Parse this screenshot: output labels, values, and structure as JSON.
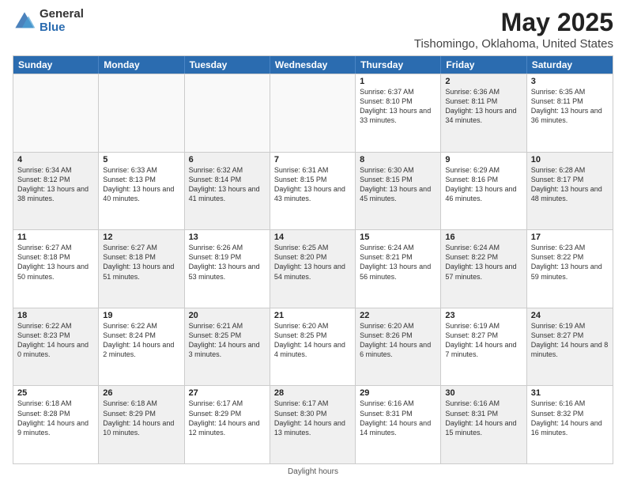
{
  "header": {
    "logo_general": "General",
    "logo_blue": "Blue",
    "month_year": "May 2025",
    "location": "Tishomingo, Oklahoma, United States"
  },
  "days_of_week": [
    "Sunday",
    "Monday",
    "Tuesday",
    "Wednesday",
    "Thursday",
    "Friday",
    "Saturday"
  ],
  "footer": {
    "daylight_hours": "Daylight hours"
  },
  "weeks": [
    [
      {
        "day": "",
        "sunrise": "",
        "sunset": "",
        "daylight": "",
        "shaded": false,
        "empty": true
      },
      {
        "day": "",
        "sunrise": "",
        "sunset": "",
        "daylight": "",
        "shaded": false,
        "empty": true
      },
      {
        "day": "",
        "sunrise": "",
        "sunset": "",
        "daylight": "",
        "shaded": false,
        "empty": true
      },
      {
        "day": "",
        "sunrise": "",
        "sunset": "",
        "daylight": "",
        "shaded": false,
        "empty": true
      },
      {
        "day": "1",
        "sunrise": "Sunrise: 6:37 AM",
        "sunset": "Sunset: 8:10 PM",
        "daylight": "Daylight: 13 hours and 33 minutes.",
        "shaded": false,
        "empty": false
      },
      {
        "day": "2",
        "sunrise": "Sunrise: 6:36 AM",
        "sunset": "Sunset: 8:11 PM",
        "daylight": "Daylight: 13 hours and 34 minutes.",
        "shaded": true,
        "empty": false
      },
      {
        "day": "3",
        "sunrise": "Sunrise: 6:35 AM",
        "sunset": "Sunset: 8:11 PM",
        "daylight": "Daylight: 13 hours and 36 minutes.",
        "shaded": false,
        "empty": false
      }
    ],
    [
      {
        "day": "4",
        "sunrise": "Sunrise: 6:34 AM",
        "sunset": "Sunset: 8:12 PM",
        "daylight": "Daylight: 13 hours and 38 minutes.",
        "shaded": true,
        "empty": false
      },
      {
        "day": "5",
        "sunrise": "Sunrise: 6:33 AM",
        "sunset": "Sunset: 8:13 PM",
        "daylight": "Daylight: 13 hours and 40 minutes.",
        "shaded": false,
        "empty": false
      },
      {
        "day": "6",
        "sunrise": "Sunrise: 6:32 AM",
        "sunset": "Sunset: 8:14 PM",
        "daylight": "Daylight: 13 hours and 41 minutes.",
        "shaded": true,
        "empty": false
      },
      {
        "day": "7",
        "sunrise": "Sunrise: 6:31 AM",
        "sunset": "Sunset: 8:15 PM",
        "daylight": "Daylight: 13 hours and 43 minutes.",
        "shaded": false,
        "empty": false
      },
      {
        "day": "8",
        "sunrise": "Sunrise: 6:30 AM",
        "sunset": "Sunset: 8:15 PM",
        "daylight": "Daylight: 13 hours and 45 minutes.",
        "shaded": true,
        "empty": false
      },
      {
        "day": "9",
        "sunrise": "Sunrise: 6:29 AM",
        "sunset": "Sunset: 8:16 PM",
        "daylight": "Daylight: 13 hours and 46 minutes.",
        "shaded": false,
        "empty": false
      },
      {
        "day": "10",
        "sunrise": "Sunrise: 6:28 AM",
        "sunset": "Sunset: 8:17 PM",
        "daylight": "Daylight: 13 hours and 48 minutes.",
        "shaded": true,
        "empty": false
      }
    ],
    [
      {
        "day": "11",
        "sunrise": "Sunrise: 6:27 AM",
        "sunset": "Sunset: 8:18 PM",
        "daylight": "Daylight: 13 hours and 50 minutes.",
        "shaded": false,
        "empty": false
      },
      {
        "day": "12",
        "sunrise": "Sunrise: 6:27 AM",
        "sunset": "Sunset: 8:18 PM",
        "daylight": "Daylight: 13 hours and 51 minutes.",
        "shaded": true,
        "empty": false
      },
      {
        "day": "13",
        "sunrise": "Sunrise: 6:26 AM",
        "sunset": "Sunset: 8:19 PM",
        "daylight": "Daylight: 13 hours and 53 minutes.",
        "shaded": false,
        "empty": false
      },
      {
        "day": "14",
        "sunrise": "Sunrise: 6:25 AM",
        "sunset": "Sunset: 8:20 PM",
        "daylight": "Daylight: 13 hours and 54 minutes.",
        "shaded": true,
        "empty": false
      },
      {
        "day": "15",
        "sunrise": "Sunrise: 6:24 AM",
        "sunset": "Sunset: 8:21 PM",
        "daylight": "Daylight: 13 hours and 56 minutes.",
        "shaded": false,
        "empty": false
      },
      {
        "day": "16",
        "sunrise": "Sunrise: 6:24 AM",
        "sunset": "Sunset: 8:22 PM",
        "daylight": "Daylight: 13 hours and 57 minutes.",
        "shaded": true,
        "empty": false
      },
      {
        "day": "17",
        "sunrise": "Sunrise: 6:23 AM",
        "sunset": "Sunset: 8:22 PM",
        "daylight": "Daylight: 13 hours and 59 minutes.",
        "shaded": false,
        "empty": false
      }
    ],
    [
      {
        "day": "18",
        "sunrise": "Sunrise: 6:22 AM",
        "sunset": "Sunset: 8:23 PM",
        "daylight": "Daylight: 14 hours and 0 minutes.",
        "shaded": true,
        "empty": false
      },
      {
        "day": "19",
        "sunrise": "Sunrise: 6:22 AM",
        "sunset": "Sunset: 8:24 PM",
        "daylight": "Daylight: 14 hours and 2 minutes.",
        "shaded": false,
        "empty": false
      },
      {
        "day": "20",
        "sunrise": "Sunrise: 6:21 AM",
        "sunset": "Sunset: 8:25 PM",
        "daylight": "Daylight: 14 hours and 3 minutes.",
        "shaded": true,
        "empty": false
      },
      {
        "day": "21",
        "sunrise": "Sunrise: 6:20 AM",
        "sunset": "Sunset: 8:25 PM",
        "daylight": "Daylight: 14 hours and 4 minutes.",
        "shaded": false,
        "empty": false
      },
      {
        "day": "22",
        "sunrise": "Sunrise: 6:20 AM",
        "sunset": "Sunset: 8:26 PM",
        "daylight": "Daylight: 14 hours and 6 minutes.",
        "shaded": true,
        "empty": false
      },
      {
        "day": "23",
        "sunrise": "Sunrise: 6:19 AM",
        "sunset": "Sunset: 8:27 PM",
        "daylight": "Daylight: 14 hours and 7 minutes.",
        "shaded": false,
        "empty": false
      },
      {
        "day": "24",
        "sunrise": "Sunrise: 6:19 AM",
        "sunset": "Sunset: 8:27 PM",
        "daylight": "Daylight: 14 hours and 8 minutes.",
        "shaded": true,
        "empty": false
      }
    ],
    [
      {
        "day": "25",
        "sunrise": "Sunrise: 6:18 AM",
        "sunset": "Sunset: 8:28 PM",
        "daylight": "Daylight: 14 hours and 9 minutes.",
        "shaded": false,
        "empty": false
      },
      {
        "day": "26",
        "sunrise": "Sunrise: 6:18 AM",
        "sunset": "Sunset: 8:29 PM",
        "daylight": "Daylight: 14 hours and 10 minutes.",
        "shaded": true,
        "empty": false
      },
      {
        "day": "27",
        "sunrise": "Sunrise: 6:17 AM",
        "sunset": "Sunset: 8:29 PM",
        "daylight": "Daylight: 14 hours and 12 minutes.",
        "shaded": false,
        "empty": false
      },
      {
        "day": "28",
        "sunrise": "Sunrise: 6:17 AM",
        "sunset": "Sunset: 8:30 PM",
        "daylight": "Daylight: 14 hours and 13 minutes.",
        "shaded": true,
        "empty": false
      },
      {
        "day": "29",
        "sunrise": "Sunrise: 6:16 AM",
        "sunset": "Sunset: 8:31 PM",
        "daylight": "Daylight: 14 hours and 14 minutes.",
        "shaded": false,
        "empty": false
      },
      {
        "day": "30",
        "sunrise": "Sunrise: 6:16 AM",
        "sunset": "Sunset: 8:31 PM",
        "daylight": "Daylight: 14 hours and 15 minutes.",
        "shaded": true,
        "empty": false
      },
      {
        "day": "31",
        "sunrise": "Sunrise: 6:16 AM",
        "sunset": "Sunset: 8:32 PM",
        "daylight": "Daylight: 14 hours and 16 minutes.",
        "shaded": false,
        "empty": false
      }
    ]
  ]
}
